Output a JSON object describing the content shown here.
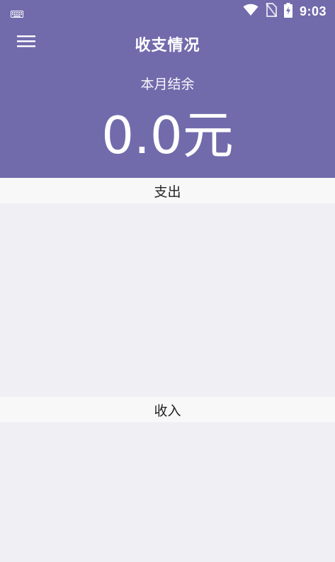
{
  "status_bar": {
    "time": "9:03",
    "left_icon": "keyboard-icon",
    "icons": [
      "wifi-icon",
      "no-sim-icon",
      "battery-charging-icon"
    ]
  },
  "app_bar": {
    "title": "收支情况",
    "menu_icon": "hamburger-menu-icon"
  },
  "summary": {
    "label": "本月结余",
    "amount": "0.0元"
  },
  "sections": {
    "expense": {
      "title": "支出"
    },
    "income": {
      "title": "收入"
    }
  },
  "colors": {
    "header_bg": "#716bac",
    "page_bg": "#efeff4",
    "section_header_bg": "#f8f8f8",
    "header_text": "#ffffff",
    "section_text": "#222222"
  }
}
